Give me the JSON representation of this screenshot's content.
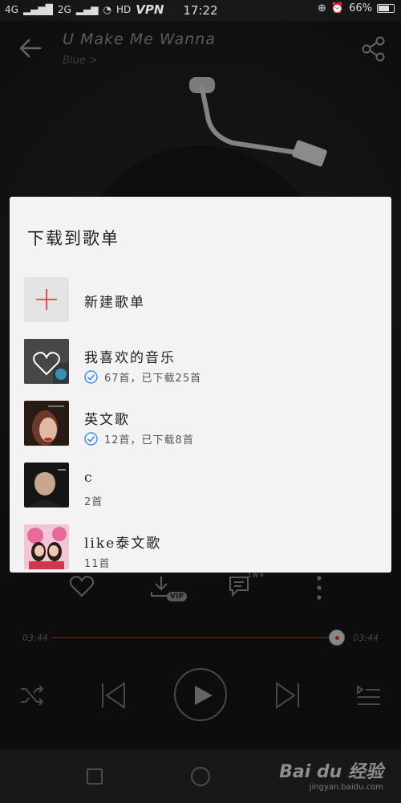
{
  "status_bar": {
    "signal_left": "4G",
    "signal_right": "2G",
    "hd": "HD",
    "vpn": "VPN",
    "time": "17:22",
    "battery": "66%"
  },
  "player": {
    "song_title": "U Make Me Wanna",
    "artist": "Blue >",
    "time_current": "03:44",
    "time_total": "03:44",
    "progress_fraction": 0.99,
    "vip_label": "VIP",
    "comment_count_badge": "1w+"
  },
  "dialog": {
    "title": "下载到歌单",
    "new_playlist_label": "新建歌单",
    "playlists": [
      {
        "name": "我喜欢的音乐",
        "sub": "67首，已下载25首",
        "downloaded": true
      },
      {
        "name": "英文歌",
        "sub": "12首，已下载8首",
        "downloaded": true
      },
      {
        "name": "c",
        "sub": "2首",
        "downloaded": false
      },
      {
        "name": "like泰文歌",
        "sub": "11首",
        "downloaded": false
      }
    ]
  },
  "watermark": {
    "logo": "Bai du 经验",
    "url": "jingyan.baidu.com"
  },
  "colors": {
    "accent_red": "#e2453c",
    "check_blue": "#3a8ee6",
    "dialog_bg": "#f3f3f3"
  }
}
